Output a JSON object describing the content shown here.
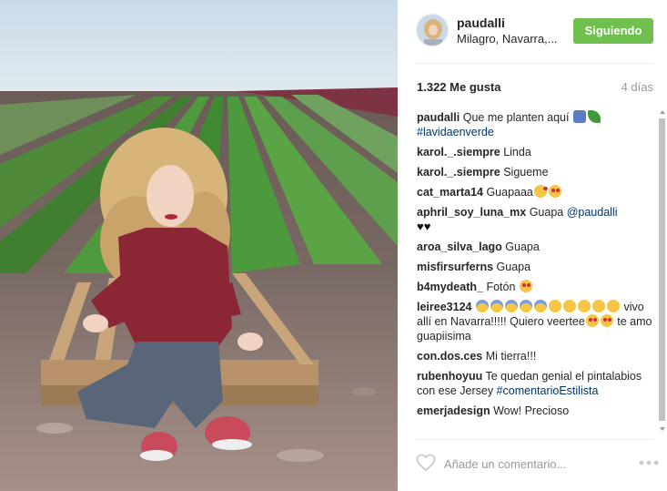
{
  "post": {
    "username": "paudalli",
    "location": "Milagro, Navarra,...",
    "follow_label": "Siguiendo",
    "likes": "1.322 Me gusta",
    "time": "4 días"
  },
  "comments": [
    {
      "user": "paudalli",
      "parts": [
        {
          "kind": "text",
          "value": "Que me planten aquí "
        },
        {
          "kind": "emoji",
          "value": "e-person"
        },
        {
          "kind": "emoji",
          "value": "e-herb"
        },
        {
          "kind": "br"
        },
        {
          "kind": "tag",
          "value": "#lavidaenverde"
        }
      ]
    },
    {
      "user": "karol._.siempre",
      "parts": [
        {
          "kind": "text",
          "value": "Linda"
        }
      ]
    },
    {
      "user": "karol._.siempre",
      "parts": [
        {
          "kind": "text",
          "value": "Sigueme"
        }
      ]
    },
    {
      "user": "cat_marta14",
      "parts": [
        {
          "kind": "text",
          "value": "Guapaaa"
        },
        {
          "kind": "emoji",
          "value": "e-kiss"
        },
        {
          "kind": "emoji",
          "value": "e-heart-eyes"
        }
      ]
    },
    {
      "user": "aphril_soy_luna_mx",
      "parts": [
        {
          "kind": "text",
          "value": "Guapa "
        },
        {
          "kind": "tag",
          "value": "@paudalli"
        },
        {
          "kind": "br"
        },
        {
          "kind": "hearts",
          "value": "♥♥"
        }
      ]
    },
    {
      "user": "aroa_silva_lago",
      "parts": [
        {
          "kind": "text",
          "value": "Guapa"
        }
      ]
    },
    {
      "user": "misfirsurferns",
      "parts": [
        {
          "kind": "text",
          "value": "Guapa"
        }
      ]
    },
    {
      "user": "b4mydeath_",
      "parts": [
        {
          "kind": "text",
          "value": "Fotón "
        },
        {
          "kind": "emoji",
          "value": "e-heart-eyes"
        }
      ]
    },
    {
      "user": "leiree3124",
      "parts": [
        {
          "kind": "text",
          "value": " "
        },
        {
          "kind": "emoji",
          "value": "e-fear"
        },
        {
          "kind": "emoji",
          "value": "e-fear"
        },
        {
          "kind": "emoji",
          "value": "e-fear"
        },
        {
          "kind": "emoji",
          "value": "e-fear"
        },
        {
          "kind": "emoji",
          "value": "e-fear"
        },
        {
          "kind": "emoji",
          "value": "e-neutral"
        },
        {
          "kind": "emoji",
          "value": "e-neutral"
        },
        {
          "kind": "emoji",
          "value": "e-neutral"
        },
        {
          "kind": "emoji",
          "value": "e-neutral"
        },
        {
          "kind": "emoji",
          "value": "e-neutral"
        },
        {
          "kind": "text",
          "value": " vivo allí en Navarra!!!!! Quiero veertee"
        },
        {
          "kind": "emoji",
          "value": "e-heart-eyes"
        },
        {
          "kind": "emoji",
          "value": "e-heart-eyes"
        },
        {
          "kind": "text",
          "value": " te amo guapiisima"
        }
      ]
    },
    {
      "user": "con.dos.ces",
      "parts": [
        {
          "kind": "text",
          "value": "Mi tierra!!!"
        }
      ]
    },
    {
      "user": "rubenhoyuu",
      "parts": [
        {
          "kind": "text",
          "value": "Te quedan genial el pintalabios con ese Jersey "
        },
        {
          "kind": "tag",
          "value": "#comentarioEstilista"
        }
      ]
    },
    {
      "user": "emerjadesign",
      "parts": [
        {
          "kind": "text",
          "value": "Wow! Precioso"
        }
      ]
    }
  ],
  "add_comment": {
    "placeholder": "Añade un comentario..."
  },
  "icons": {
    "like": "heart-outline-icon",
    "more": "more-options-icon"
  },
  "colors": {
    "follow": "#70c050",
    "hashtag": "#003569"
  }
}
